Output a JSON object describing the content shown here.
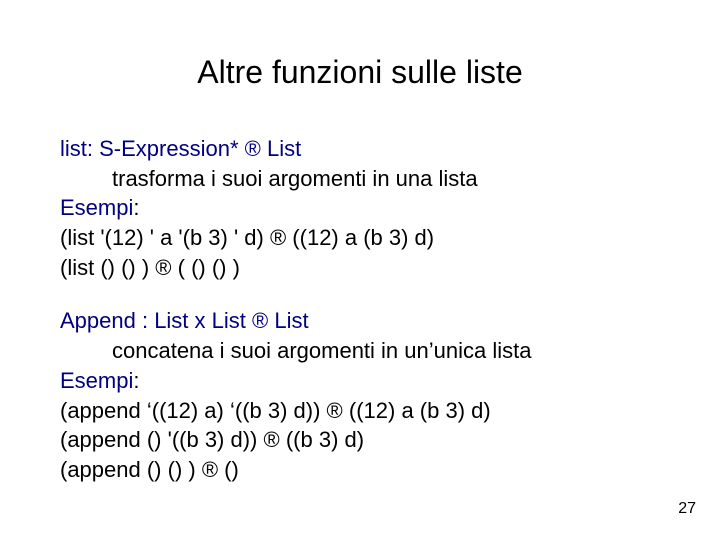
{
  "title": "Altre funzioni sulle liste",
  "block1": {
    "sig_pre": "list: S-Expression* ",
    "sig_arrow": "®",
    "sig_post": " List",
    "desc": "trasforma i suoi argomenti in una lista",
    "esempi_label": "Esempi",
    "esempi_colon": ":",
    "ex1_pre": "(list '(12) ' a '(b 3) ' d) ",
    "ex1_arrow": "®",
    "ex1_post": " ((12) a (b 3) d)",
    "ex2_pre": "(list  () () ) ",
    "ex2_arrow": "®",
    "ex2_post": " ( () () )"
  },
  "block2": {
    "sig_pre": "Append : List x List ",
    "sig_arrow": "®",
    "sig_post": " List",
    "desc": "concatena i suoi argomenti in un’unica lista",
    "esempi_label": "Esempi",
    "esempi_colon": ":",
    "ex1_pre": "(append ‘((12) a) ‘((b 3) d)) ",
    "ex1_arrow": "®",
    "ex1_post": " ((12) a (b 3) d)",
    "ex2_pre": "(append () '((b 3) d)) ",
    "ex2_arrow": "®",
    "ex2_post": " ((b 3) d)",
    "ex3_pre": "(append  () () ) ",
    "ex3_arrow": "®",
    "ex3_post": " ()"
  },
  "page_number": "27"
}
